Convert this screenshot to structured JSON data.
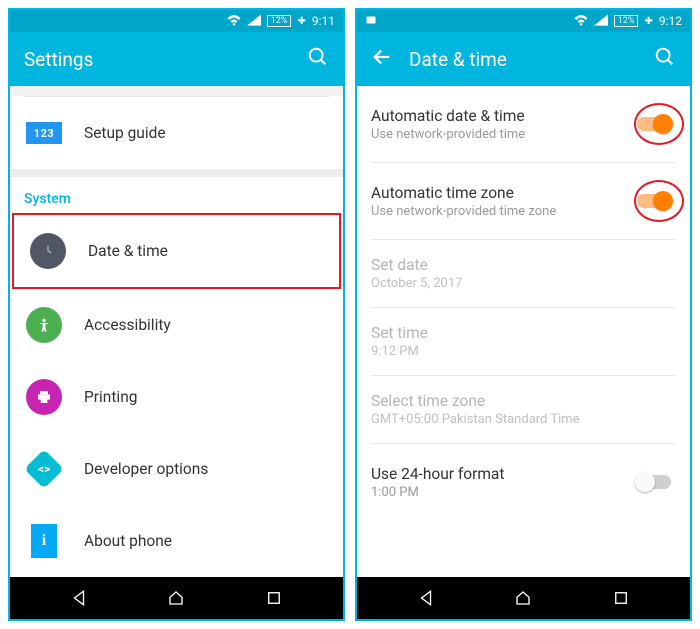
{
  "left": {
    "status": {
      "battery": "12%",
      "time": "9:11"
    },
    "appbar": {
      "title": "Settings"
    },
    "setup_guide": {
      "label": "Setup guide",
      "icon_text": "123"
    },
    "section_system": "System",
    "items": {
      "date_time": {
        "label": "Date & time"
      },
      "accessibility": {
        "label": "Accessibility"
      },
      "printing": {
        "label": "Printing"
      },
      "developer": {
        "label": "Developer options"
      },
      "about": {
        "label": "About phone",
        "icon_text": "i"
      }
    }
  },
  "right": {
    "status": {
      "battery": "12%",
      "time": "9:12"
    },
    "appbar": {
      "title": "Date & time"
    },
    "items": {
      "auto_date": {
        "label": "Automatic date & time",
        "sub": "Use network-provided time"
      },
      "auto_tz": {
        "label": "Automatic time zone",
        "sub": "Use network-provided time zone"
      },
      "set_date": {
        "label": "Set date",
        "sub": "October 5, 2017"
      },
      "set_time": {
        "label": "Set time",
        "sub": "9:12 PM"
      },
      "sel_tz": {
        "label": "Select time zone",
        "sub": "GMT+05:00 Pakistan Standard Time"
      },
      "use_24h": {
        "label": "Use 24-hour format",
        "sub": "1:00 PM"
      }
    }
  }
}
